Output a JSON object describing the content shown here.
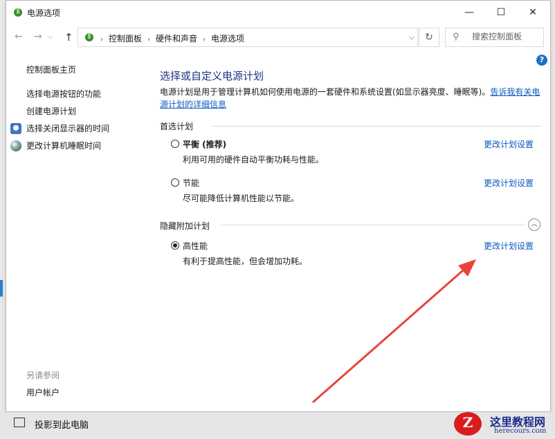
{
  "window": {
    "title": "电源选项",
    "controls": {
      "minimize": "—",
      "maximize": "☐",
      "close": "✕"
    }
  },
  "address": {
    "nav": {
      "back": "←",
      "forward": "→",
      "up": "↑"
    },
    "breadcrumbs": [
      "控制面板",
      "硬件和声音",
      "电源选项"
    ],
    "separator": "›",
    "dropdown": "⌵",
    "refresh": "↻",
    "search_placeholder": "搜索控制面板",
    "search_icon": "⚲"
  },
  "help": "?",
  "sidebar": {
    "home": "控制面板主页",
    "items": [
      {
        "label": "选择电源按钮的功能",
        "icon": ""
      },
      {
        "label": "创建电源计划",
        "icon": ""
      },
      {
        "label": "选择关闭显示器的时间",
        "icon": "clock-icon"
      },
      {
        "label": "更改计算机睡眠时间",
        "icon": "moon-icon"
      }
    ],
    "see_also": "另请参阅",
    "user_accounts": "用户帐户"
  },
  "main": {
    "heading": "选择或自定义电源计划",
    "description": "电源计划是用于管理计算机如何使用电源的一套硬件和系统设置(如显示器亮度、睡眠等)。",
    "description_link": "告诉我有关电源计划的详细信息",
    "preferred_group": "首选计划",
    "hidden_group": "隐藏附加计划",
    "collapse_glyph": "︿",
    "plans": [
      {
        "name": "平衡 (推荐)",
        "desc": "利用可用的硬件自动平衡功耗与性能。",
        "link": "更改计划设置",
        "selected": false
      },
      {
        "name": "节能",
        "desc": "尽可能降低计算机性能以节能。",
        "link": "更改计划设置",
        "selected": false
      },
      {
        "name": "高性能",
        "desc": "有利于提高性能，但会增加功耗。",
        "link": "更改计划设置",
        "selected": true
      }
    ]
  },
  "taskbar": {
    "label": "投影到此电脑"
  },
  "watermark": {
    "title": "这里教程网",
    "url": "herecours.com"
  },
  "colors": {
    "link": "#0b57c0",
    "heading": "#1e3287",
    "arrow": "#e8443a"
  }
}
